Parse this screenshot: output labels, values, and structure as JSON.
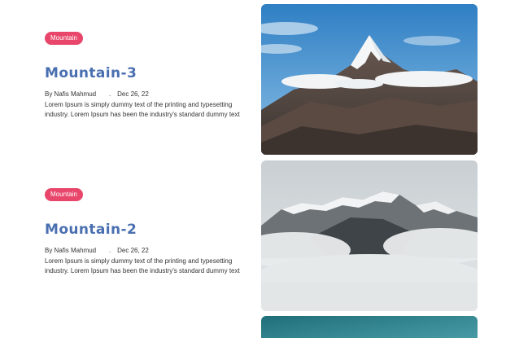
{
  "posts": [
    {
      "category": "Mountain",
      "title": "Mountain-3",
      "author": "By Nafis Mahmud",
      "separator": ".",
      "date": "Dec 26, 22",
      "excerpt": "Lorem Ipsum is simply dummy text of the printing and typesetting industry. Lorem Ipsum has been the industry's standard dummy text",
      "image": "snowy-peak-blue-sky"
    },
    {
      "category": "Mountain",
      "title": "Mountain-2",
      "author": "By Nafis Mahmud",
      "separator": ".",
      "date": "Dec 26, 22",
      "excerpt": "Lorem Ipsum is simply dummy text of the printing and typesetting industry. Lorem Ipsum has been the industry's standard dummy text",
      "image": "misty-mountain-ridge"
    },
    {
      "image": "teal-sky-partial"
    }
  ],
  "colors": {
    "badge": "#e8466b",
    "title": "#4a6fb0",
    "text": "#333333"
  }
}
